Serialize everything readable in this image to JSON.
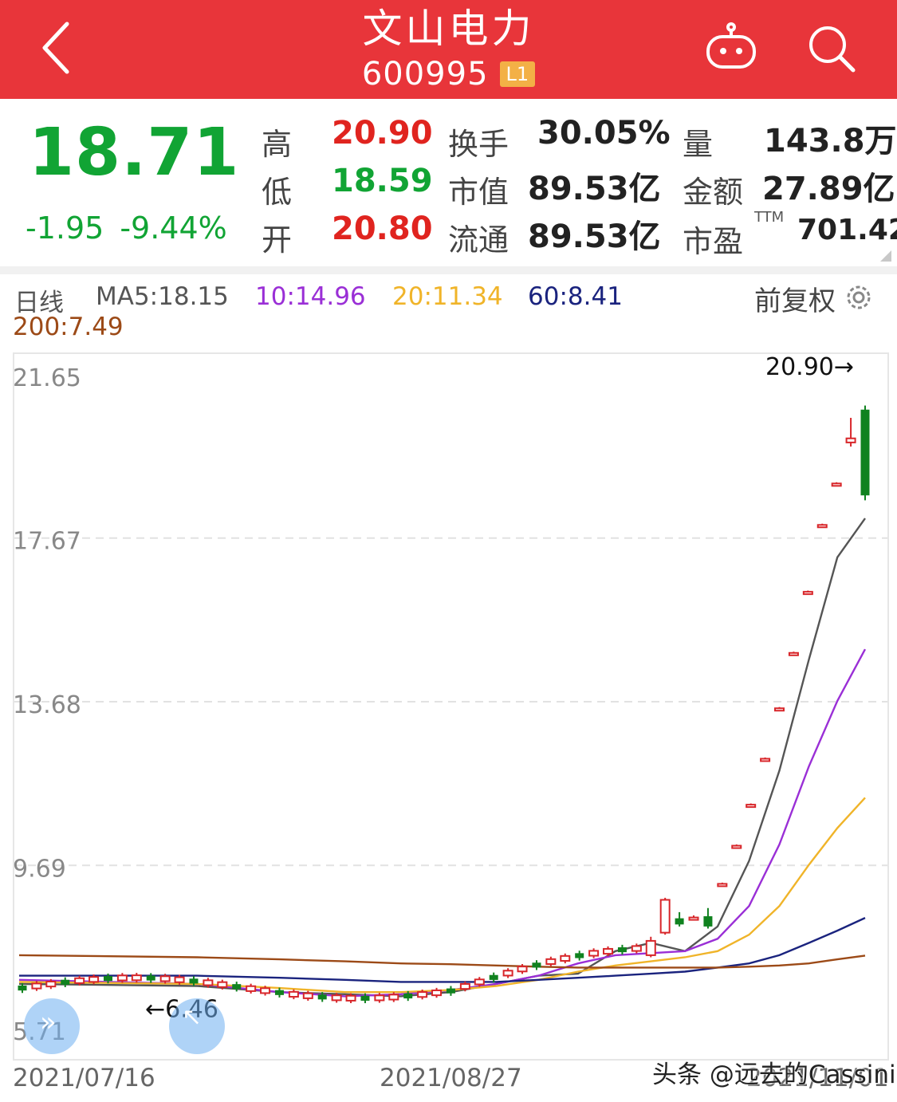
{
  "header": {
    "title": "文山电力",
    "code": "600995",
    "level_badge": "L1",
    "bg_color": "#e8353a"
  },
  "quote": {
    "last_price": "18.71",
    "change": "-1.95",
    "change_pct": "-9.44%",
    "fields": {
      "high": {
        "label": "高",
        "value": "20.90"
      },
      "low": {
        "label": "低",
        "value": "18.59"
      },
      "open": {
        "label": "开",
        "value": "20.80"
      },
      "turnover": {
        "label": "换手",
        "value": "30.05%"
      },
      "mkt_cap": {
        "label": "市值",
        "value": "89.53亿"
      },
      "float_cap": {
        "label": "流通",
        "value": "89.53亿"
      },
      "volume": {
        "label": "量",
        "value": "143.8万"
      },
      "amount": {
        "label": "金额",
        "value": "27.89亿"
      },
      "pe": {
        "label": "市盈",
        "superscript": "TTM",
        "value": "701.42"
      }
    },
    "up_color": "#e0241f",
    "down_color": "#11a434"
  },
  "ma_legend": {
    "period_label": "日线",
    "ma5": "MA5:18.15",
    "ma10": "10:14.96",
    "ma20": "20:11.34",
    "ma60": "60:8.41",
    "ma200": "200:7.49",
    "adjust_label": "前复权"
  },
  "chart_data": {
    "type": "candlestick",
    "y_ticks": [
      "21.65",
      "17.67",
      "13.68",
      "9.69",
      "5.71"
    ],
    "ylim": [
      5.71,
      21.65
    ],
    "x_labels": [
      "2021/07/16",
      "2021/08/27",
      "2021/11/01"
    ],
    "high_marker": "20.90→",
    "low_marker": "←6.46",
    "grid": true,
    "candles_tail": [
      {
        "open": 7.5,
        "close": 7.85,
        "high": 7.95,
        "low": 7.45
      },
      {
        "open": 8.05,
        "close": 8.85,
        "high": 8.9,
        "low": 8.0
      },
      {
        "open": 8.4,
        "close": 8.25,
        "high": 8.55,
        "low": 8.2
      },
      {
        "open": 8.42,
        "close": 8.42,
        "high": 8.47,
        "low": 8.37
      },
      {
        "open": 8.45,
        "close": 8.2,
        "high": 8.65,
        "low": 8.15
      },
      {
        "open": 9.24,
        "close": 9.24,
        "high": 9.27,
        "low": 9.21
      },
      {
        "open": 10.17,
        "close": 10.17,
        "high": 10.2,
        "low": 10.14
      },
      {
        "open": 11.17,
        "close": 11.17,
        "high": 11.2,
        "low": 11.14
      },
      {
        "open": 12.29,
        "close": 12.29,
        "high": 12.32,
        "low": 12.26
      },
      {
        "open": 13.52,
        "close": 13.52,
        "high": 13.55,
        "low": 13.49
      },
      {
        "open": 14.87,
        "close": 14.87,
        "high": 14.9,
        "low": 14.84
      },
      {
        "open": 16.36,
        "close": 16.36,
        "high": 16.39,
        "low": 16.33
      },
      {
        "open": 17.99,
        "close": 17.99,
        "high": 18.02,
        "low": 17.96
      },
      {
        "open": 19.0,
        "close": 19.0,
        "high": 19.03,
        "low": 18.97
      },
      {
        "open": 20.0,
        "close": 20.1,
        "high": 20.6,
        "low": 19.9
      },
      {
        "open": 20.8,
        "close": 18.71,
        "high": 20.9,
        "low": 18.59
      }
    ],
    "series": [
      {
        "name": "MA5",
        "color": "#555555",
        "values": [
          6.8,
          6.75,
          6.6,
          6.55,
          6.5,
          6.6,
          6.8,
          7.0,
          7.05,
          7.6,
          7.8,
          7.6,
          8.2,
          9.8,
          12.0,
          14.7,
          17.2,
          18.15
        ]
      },
      {
        "name": "MA10",
        "color": "#9a2fd6",
        "values": [
          6.9,
          6.8,
          6.6,
          6.5,
          6.55,
          6.65,
          6.8,
          7.0,
          7.3,
          7.5,
          7.55,
          7.6,
          7.9,
          8.7,
          10.2,
          12.1,
          13.7,
          14.96
        ]
      },
      {
        "name": "MA20",
        "color": "#f0b429",
        "values": [
          6.85,
          6.8,
          6.7,
          6.6,
          6.6,
          6.65,
          6.75,
          6.9,
          7.1,
          7.25,
          7.35,
          7.45,
          7.6,
          8.0,
          8.7,
          9.7,
          10.6,
          11.34
        ]
      },
      {
        "name": "MA60",
        "color": "#1a237e",
        "values": [
          7.0,
          7.0,
          6.95,
          6.9,
          6.85,
          6.85,
          6.85,
          6.9,
          6.95,
          7.0,
          7.05,
          7.1,
          7.2,
          7.3,
          7.5,
          7.8,
          8.1,
          8.41
        ]
      },
      {
        "name": "MA200",
        "color": "#9c4a17",
        "values": [
          7.5,
          7.45,
          7.4,
          7.35,
          7.3,
          7.28,
          7.25,
          7.22,
          7.2,
          7.2,
          7.2,
          7.2,
          7.2,
          7.22,
          7.25,
          7.3,
          7.4,
          7.49
        ]
      }
    ]
  },
  "watermark": "头条 @远去的Cassini"
}
